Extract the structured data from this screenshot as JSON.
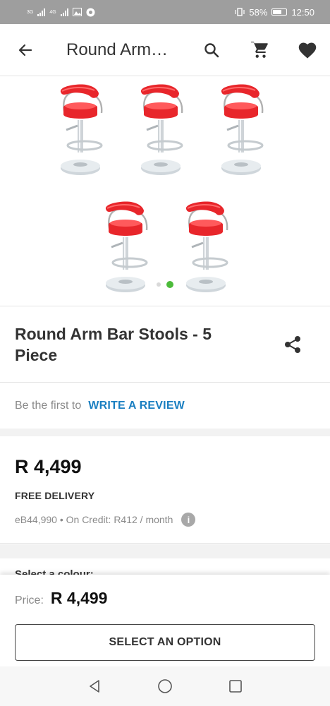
{
  "status_bar": {
    "network_1": "3G",
    "network_2": "4G",
    "battery": "58%",
    "time": "12:50"
  },
  "app_bar": {
    "title": "Round Arm…",
    "icons": [
      "back-arrow-icon",
      "search-icon",
      "cart-icon",
      "heart-icon"
    ]
  },
  "gallery": {
    "image_count": 5,
    "dots": 2,
    "active_dot": 1,
    "stool_color": "#e8262b"
  },
  "product": {
    "title": "Round Arm Bar Stools - 5 Piece"
  },
  "review": {
    "prompt": "Be the first to",
    "link": "WRITE A REVIEW"
  },
  "pricing": {
    "price": "R 4,499",
    "delivery": "FREE DELIVERY",
    "credit": "eB44,990 • On Credit: R412 / month",
    "info": "i"
  },
  "colour_section": {
    "label": "Select a colour:"
  },
  "bottom_sheet": {
    "price_label": "Price:",
    "price_value": "R 4,499",
    "button_label": "SELECT AN OPTION"
  },
  "colors": {
    "accent_link": "#1a7fc1",
    "active_dot": "#4cbb3a"
  }
}
